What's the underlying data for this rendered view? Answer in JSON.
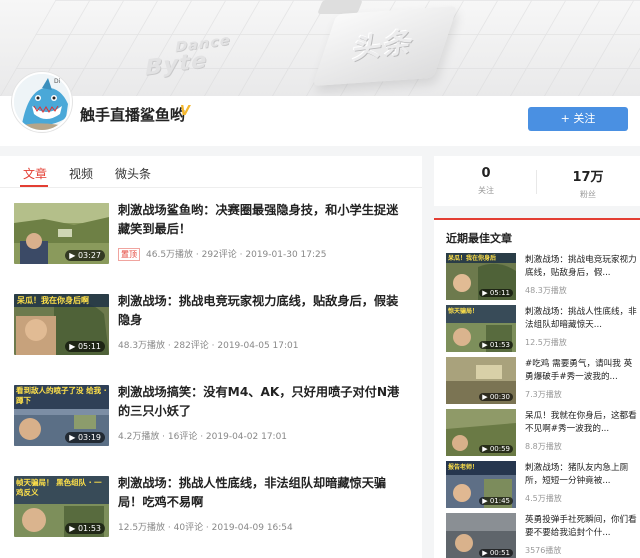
{
  "banner": {
    "bytedance_top": "Dance",
    "bytedance_bottom": "Byte",
    "toutiao": "头条"
  },
  "profile": {
    "avatar_tag": "Di",
    "name": "触手直播鲨鱼哟",
    "verified_mark": "V",
    "follow_label": "+ 关注"
  },
  "tabs": [
    {
      "label": "文章"
    },
    {
      "label": "视频"
    },
    {
      "label": "微头条"
    }
  ],
  "articles": [
    {
      "title": "刺激战场鲨鱼哟：决赛圈最强隐身技，和小学生捉迷藏笑到最后！",
      "duration": "▶ 03:27",
      "tag": "置顶",
      "meta": "46.5万播放 · 292评论 · 2019-01-30 17:25",
      "thumb_caption": ""
    },
    {
      "title": "刺激战场：挑战电竞玩家视力底线，贴敌身后，假装隐身",
      "duration": "▶ 05:11",
      "tag": "",
      "meta": "48.3万播放 · 282评论 · 2019-04-05 17:01",
      "thumb_caption": "呆瓜！我在你身后啊"
    },
    {
      "title": "刺激战场搞笑：没有M4、AK，只好用喷子对付N港的三只小妖了",
      "duration": "▶ 03:19",
      "tag": "",
      "meta": "4.2万播放 · 16评论 · 2019-04-02 17:01",
      "thumb_caption": "看到敌人的喷子了没 给我 · 蹲下"
    },
    {
      "title": "刺激战场：挑战人性底线，非法组队却暗藏惊天骗局！吃鸡不易啊",
      "duration": "▶ 01:53",
      "tag": "",
      "meta": "12.5万播放 · 40评论 · 2019-04-09 16:54",
      "thumb_caption": "帧天骗局！ 黑色组队 · 一鸡反义"
    }
  ],
  "stats": {
    "following_count": "0",
    "following_label": "关注",
    "fans_count": "17万",
    "fans_label": "粉丝"
  },
  "best": {
    "title": "近期最佳文章",
    "items": [
      {
        "title": "刺激战场：挑战电竞玩家视力底线，贴敌身后，假...",
        "count": "48.3万播放",
        "duration": "▶ 05:11",
        "caption": "呆瓜！我在你身后"
      },
      {
        "title": "刺激战场：挑战人性底线，非法组队却暗藏惊天...",
        "count": "12.5万播放",
        "duration": "▶ 01:53",
        "caption": "惊天骗局！"
      },
      {
        "title": "#吃鸡 需要勇气，请叫我 英勇爆破手#秀一波我的...",
        "count": "7.3万播放",
        "duration": "▶ 00:30",
        "caption": ""
      },
      {
        "title": "呆瓜！我就在你身后，这都看不见啊#秀一波我的...",
        "count": "8.8万播放",
        "duration": "▶ 00:59",
        "caption": ""
      },
      {
        "title": "刺激战场：猪队友内急上厕所，短短一分钟竟被...",
        "count": "4.5万播放",
        "duration": "▶ 01:45",
        "caption": "报告老师！"
      },
      {
        "title": "英勇投弹手社死瞬间，你们看要不要给我追封个什...",
        "count": "3576播放",
        "duration": "▶ 00:51",
        "caption": ""
      }
    ]
  }
}
